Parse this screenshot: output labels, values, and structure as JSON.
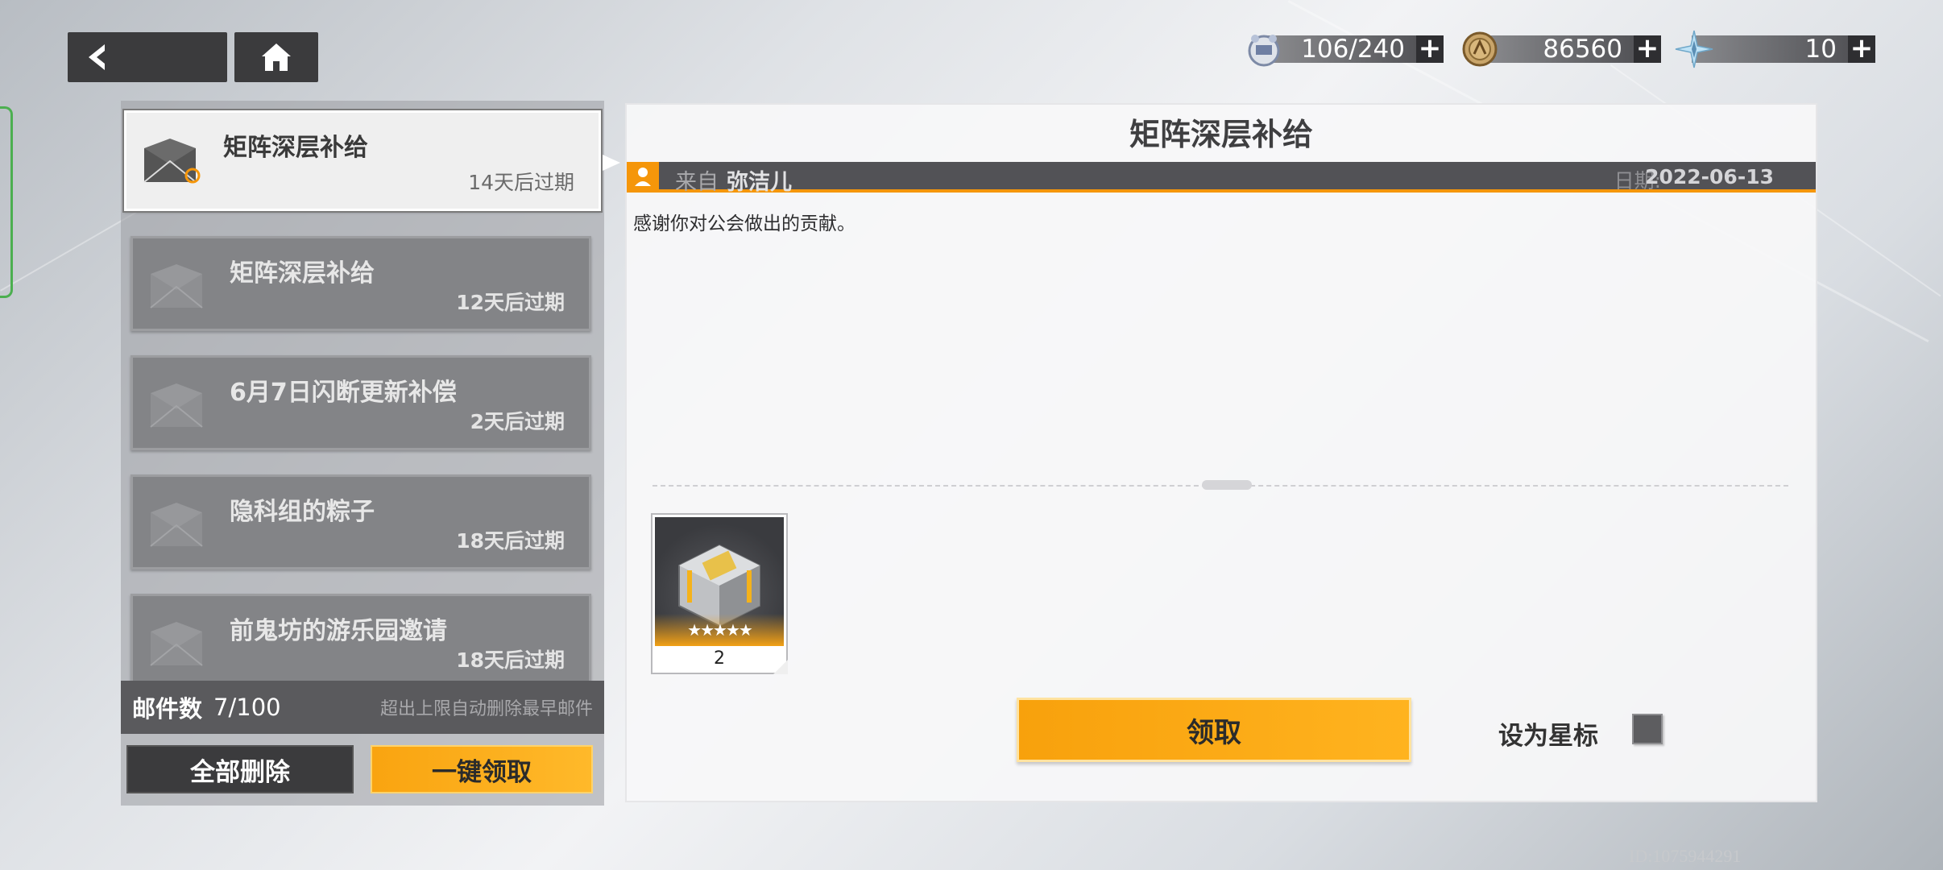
{
  "resources": [
    {
      "icon": "stamina-drone-icon",
      "value": "106/240"
    },
    {
      "icon": "coin-icon",
      "value": "86560"
    },
    {
      "icon": "crystal-icon",
      "value": "10"
    }
  ],
  "mail_list": [
    {
      "title": "矩阵深层补给",
      "expiry": "14天后过期",
      "active": true
    },
    {
      "title": "矩阵深层补给",
      "expiry": "12天后过期",
      "active": false
    },
    {
      "title": "6月7日闪断更新补偿",
      "expiry": "2天后过期",
      "active": false
    },
    {
      "title": "隐科组的粽子",
      "expiry": "18天后过期",
      "active": false
    },
    {
      "title": "前鬼坊的游乐园邀请",
      "expiry": "18天后过期",
      "active": false
    }
  ],
  "mail_count": {
    "label": "邮件数",
    "value": "7/100",
    "hint": "超出上限自动删除最早邮件"
  },
  "buttons": {
    "delete_all": "全部删除",
    "claim_all": "一键领取",
    "claim": "领取",
    "star_label": "设为星标"
  },
  "detail": {
    "title": "矩阵深层补给",
    "from_label": "来自",
    "from_name": "弥洁儿",
    "date_label": "日期:",
    "date": "2022-06-13",
    "body": "感谢你对公会做出的贡献。"
  },
  "reward": {
    "stars": "★★★★★",
    "quantity": "2"
  },
  "uid": "ID:1075944291",
  "colors": {
    "accent": "#f5960a",
    "panel_dark": "#525256"
  }
}
